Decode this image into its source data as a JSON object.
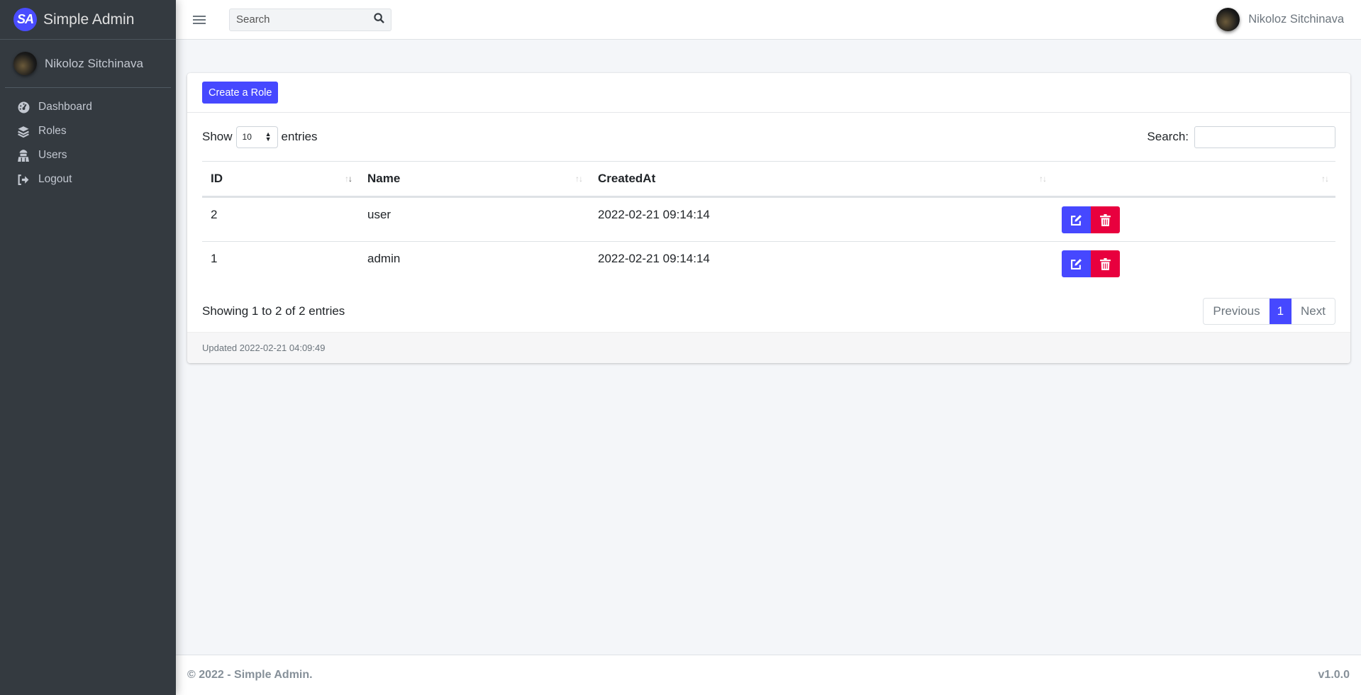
{
  "brand": {
    "logo": "SA",
    "name": "Simple Admin"
  },
  "user": {
    "name": "Nikoloz Sitchinava"
  },
  "sidebar": {
    "items": [
      {
        "label": "Dashboard",
        "icon": "tachometer-icon"
      },
      {
        "label": "Roles",
        "icon": "layers-icon"
      },
      {
        "label": "Users",
        "icon": "users-icon"
      },
      {
        "label": "Logout",
        "icon": "sign-out-icon"
      }
    ]
  },
  "header": {
    "search_placeholder": "Search"
  },
  "card": {
    "create_label": "Create a Role",
    "length": {
      "show": "Show",
      "value": "10",
      "entries": "entries"
    },
    "filter_label": "Search:",
    "columns": [
      "ID",
      "Name",
      "CreatedAt",
      ""
    ],
    "rows": [
      {
        "id": "2",
        "name": "user",
        "created": "2022-02-21 09:14:14"
      },
      {
        "id": "1",
        "name": "admin",
        "created": "2022-02-21 09:14:14"
      }
    ],
    "info": "Showing 1 to 2 of 2 entries",
    "pager": {
      "prev": "Previous",
      "page": "1",
      "next": "Next"
    },
    "updated": "Updated 2022-02-21 04:09:49"
  },
  "footer": {
    "copyright": "© 2022 - Simple Admin.",
    "version": "v1.0.0"
  },
  "colors": {
    "primary": "#4648ff",
    "danger": "#e8003e",
    "sidebar": "#343a40"
  }
}
